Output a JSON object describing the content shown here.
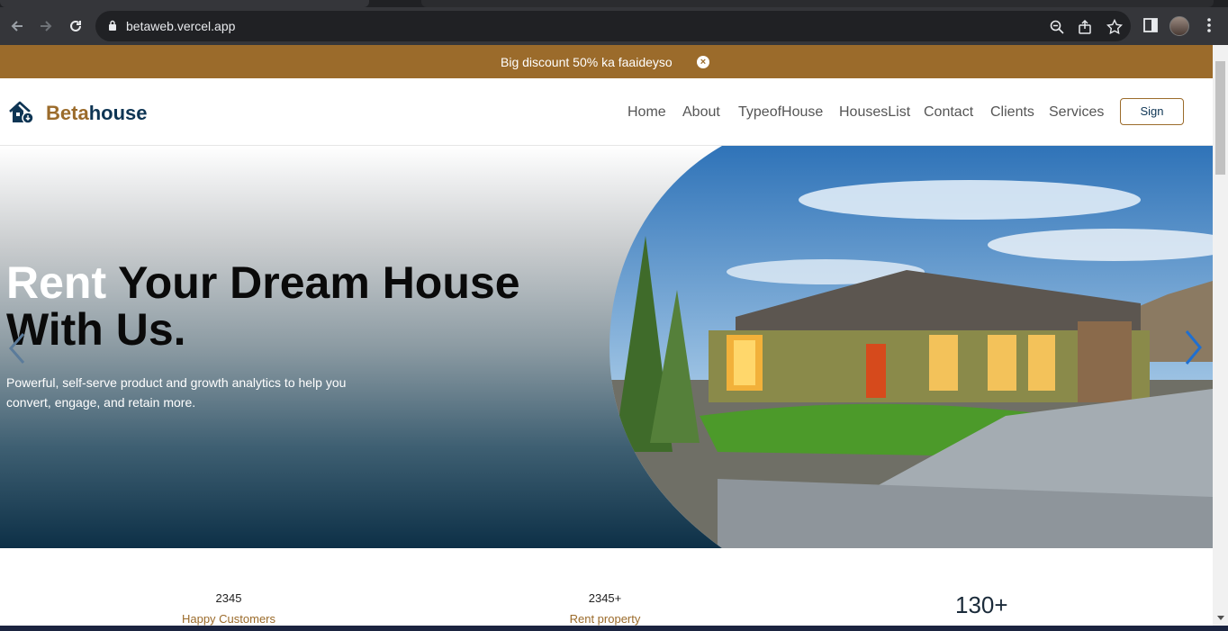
{
  "browser": {
    "url": "betaweb.vercel.app"
  },
  "promo": {
    "text": "Big discount 50% ka faaideyso",
    "close_icon": "close-circle-icon"
  },
  "brand": {
    "part1": "Beta",
    "part2": "house",
    "colors": {
      "accent": "#9b6b2b",
      "primary": "#0e3554"
    }
  },
  "nav": {
    "items": [
      "Home",
      "About",
      "TypeofHouse",
      "HousesList",
      "Contact",
      "Clients",
      "Services"
    ],
    "sign_label": "Sign"
  },
  "hero": {
    "title_part1": "Rent",
    "title_part2": " Your Dream House",
    "title_line2": "With Us.",
    "subtitle": "Powerful, self-serve product and growth analytics to help you convert, engage, and retain more."
  },
  "stats": [
    {
      "value": "2345",
      "label": "Happy Customers"
    },
    {
      "value": "2345+",
      "label": "Rent property"
    },
    {
      "value": "130+",
      "label": ""
    }
  ]
}
